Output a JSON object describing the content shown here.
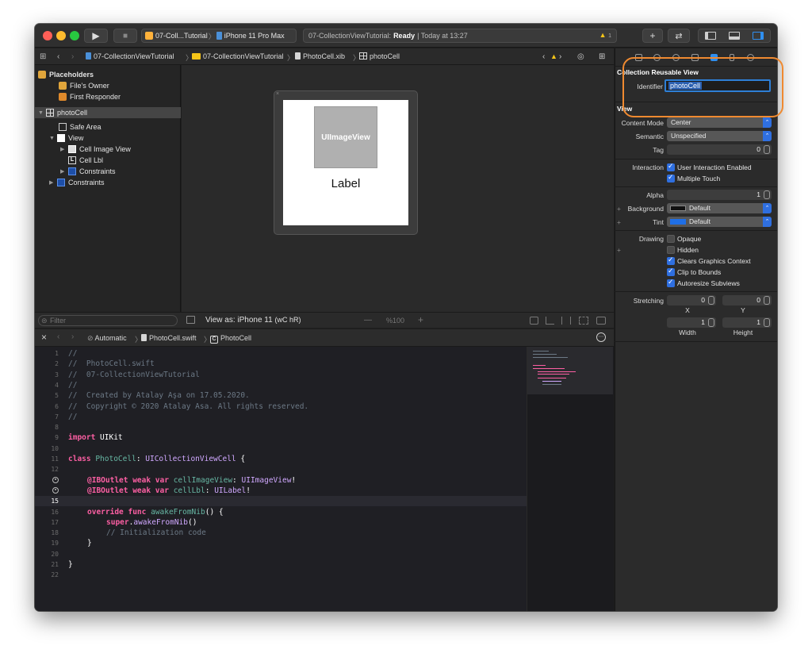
{
  "toolbar": {
    "run_glyph": "▶",
    "stop_glyph": "■",
    "scheme_name": "07-Coll...Tutorial",
    "scheme_sep": "〉",
    "device_name": "iPhone 11 Pro Max",
    "activity_project": "07-CollectionViewTutorial:",
    "activity_status": "Ready",
    "activity_time": "| Today at 13:27",
    "warning_glyph": "▲",
    "warning_count": "1",
    "library_glyph": "+",
    "review_glyph": "⇄"
  },
  "jumpbar": {
    "project": "07-CollectionViewTutorial",
    "folder": "07-CollectionViewTutorial",
    "file": "PhotoCell.xib",
    "object": "photoCell",
    "sep": "〉"
  },
  "outline": {
    "placeholders": "Placeholders",
    "files_owner": "File's Owner",
    "first_responder": "First Responder",
    "photo_cell": "photoCell",
    "safe_area": "Safe Area",
    "view": "View",
    "cell_image_view": "Cell Image View",
    "cell_lbl": "Cell Lbl",
    "constraints_inner": "Constraints",
    "constraints_outer": "Constraints",
    "filter_placeholder": "Filter"
  },
  "canvas": {
    "image_view_text": "UIImageView",
    "label_text": "Label",
    "view_as": "View as: iPhone 11",
    "view_as_traits": "(wC hR)",
    "zoom_minus": "—",
    "zoom": "%100",
    "zoom_plus": "+"
  },
  "editor_bar": {
    "close": "×",
    "mode": "Automatic",
    "file": "PhotoCell.swift",
    "symbol": "PhotoCell",
    "sep": "〉",
    "more_glyph": "⋯"
  },
  "code": {
    "l1": "//",
    "l2": "//  PhotoCell.swift",
    "l3": "//  07-CollectionViewTutorial",
    "l4": "//",
    "l5": "//  Created by Atalay Aşa on 17.05.2020.",
    "l6": "//  Copyright © 2020 Atalay Asa. All rights reserved.",
    "l7": "//",
    "l9_kw": "import",
    "l9_name": " UIKit",
    "l11_kw": "class",
    "l11_name": " PhotoCell",
    "l11_colon": ": ",
    "l11_super": "UICollectionViewCell",
    "l11_brace": " {",
    "l13_attr": "@IBOutlet",
    "l13_kw": " weak var",
    "l13_name": " cellImageView",
    "l13_colon": ": ",
    "l13_type": "UIImageView",
    "l13_bang": "!",
    "l14_attr": "@IBOutlet",
    "l14_kw": " weak var",
    "l14_name": " cellLbl",
    "l14_colon": ": ",
    "l14_type": "UILabel",
    "l14_bang": "!",
    "l16_kw": "override func",
    "l16_name": " awakeFromNib",
    "l16_rest": "() {",
    "l17_kw": "super",
    "l17_dot": ".",
    "l17_name": "awakeFromNib",
    "l17_rest": "()",
    "l18": "// Initialization code",
    "l19": "}",
    "l21": "}"
  },
  "inspector": {
    "section_reusable": "Collection Reusable View",
    "identifier_label": "Identifier",
    "identifier_value": "photoCell",
    "section_view": "View",
    "content_mode_label": "Content Mode",
    "content_mode_value": "Center",
    "semantic_label": "Semantic",
    "semantic_value": "Unspecified",
    "tag_label": "Tag",
    "tag_value": "0",
    "interaction_label": "Interaction",
    "user_interaction": "User Interaction Enabled",
    "multiple_touch": "Multiple Touch",
    "alpha_label": "Alpha",
    "alpha_value": "1",
    "background_label": "Background",
    "background_value": "Default",
    "tint_label": "Tint",
    "tint_value": "Default",
    "drawing_label": "Drawing",
    "opaque": "Opaque",
    "hidden": "Hidden",
    "clears_graphics": "Clears Graphics Context",
    "clip_to_bounds": "Clip to Bounds",
    "autoresize": "Autoresize Subviews",
    "stretching_label": "Stretching",
    "x_value": "0",
    "y_value": "0",
    "x_label": "X",
    "y_label": "Y",
    "width_value": "1",
    "height_value": "1",
    "width_label": "Width",
    "height_label": "Height",
    "plus_glyph": "+"
  },
  "colors": {
    "accent": "#2f6fe0",
    "highlight_ring": "#f08a30",
    "tint_swatch": "#1f6fe6"
  }
}
